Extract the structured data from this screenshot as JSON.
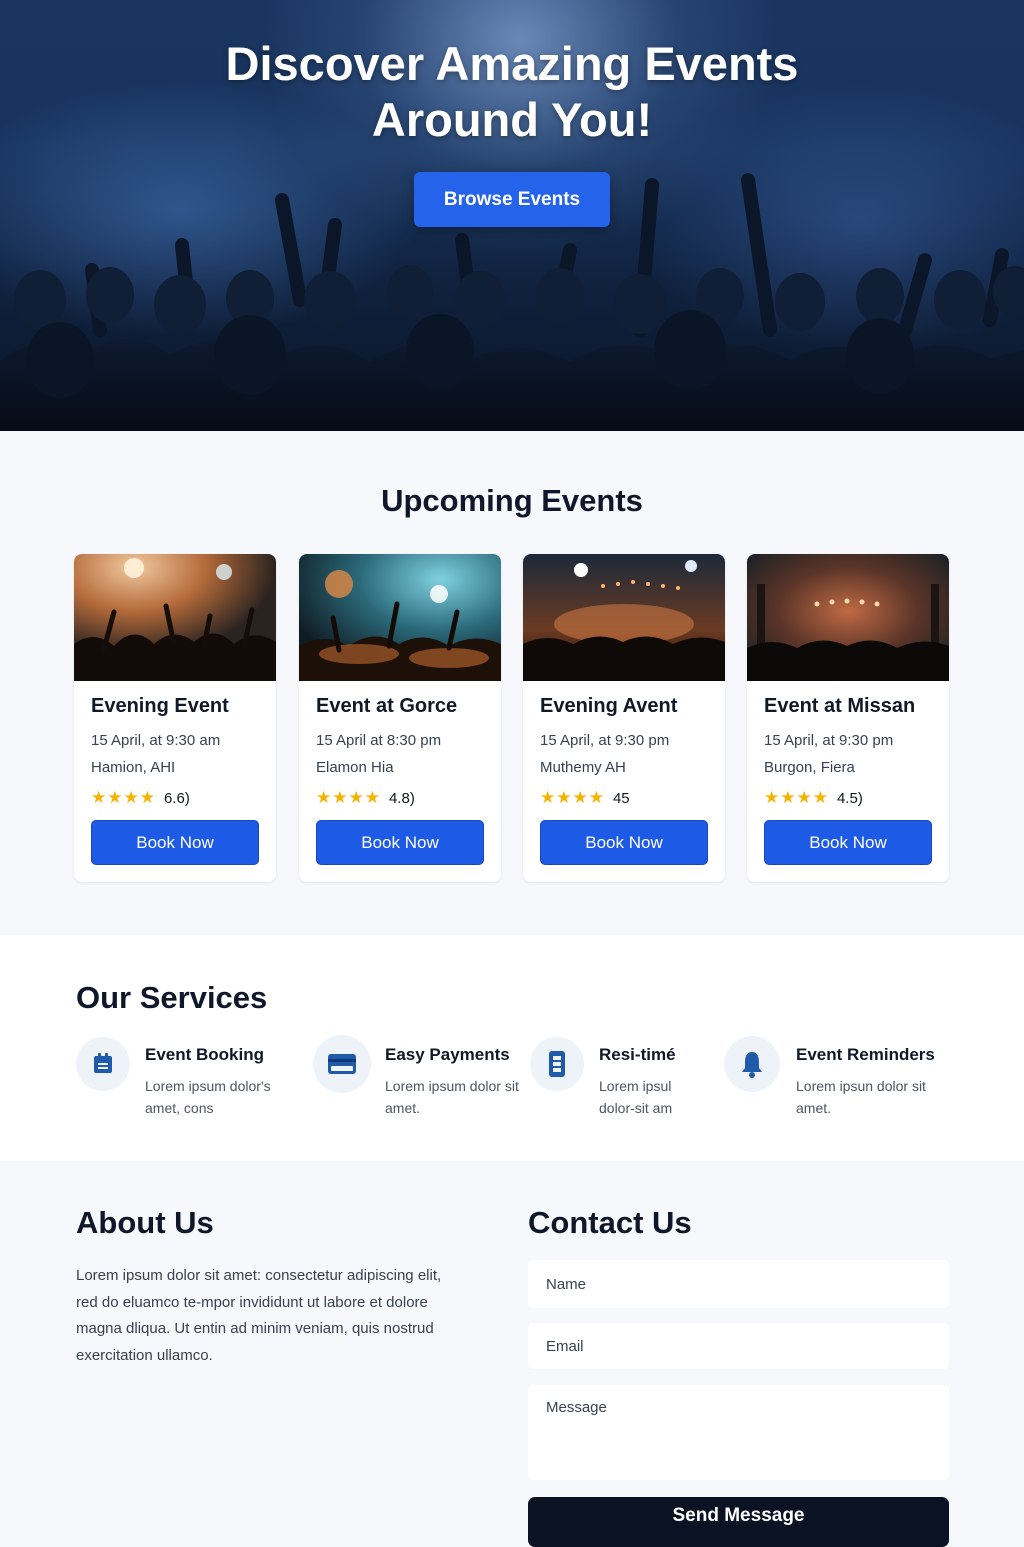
{
  "hero": {
    "title_line1": "Discover Amazing Events",
    "title_line2": "Around You!",
    "cta_label": "Browse Events"
  },
  "events": {
    "title": "Upcoming Events",
    "items": [
      {
        "name": "Evening Event",
        "date": "15 April, at 9:30 am",
        "location": "Hamion, AHI",
        "rating": "6.6)",
        "stars": "★★★★",
        "button": "Book Now"
      },
      {
        "name": "Event at Gorce",
        "date": "15 April at 8:30 pm",
        "location": "Elamon Hia",
        "rating": "4.8)",
        "stars": "★★★★",
        "button": "Book Now"
      },
      {
        "name": "Evening Avent",
        "date": "15 April, at 9:30 pm",
        "location": "Muthemy AH",
        "rating": "45",
        "stars": "★★★★",
        "button": "Book Now"
      },
      {
        "name": "Event at Missan",
        "date": "15 April, at 9:30 pm",
        "location": "Burgon, Fiera",
        "rating": "4.5)",
        "stars": "★★★★",
        "button": "Book Now"
      }
    ]
  },
  "services": {
    "title": "Our Services",
    "items": [
      {
        "name": "Event Booking",
        "desc": "Lorem ipsum dolor's amet, cons",
        "icon": "calendar-icon"
      },
      {
        "name": "Easy Payments",
        "desc": "Lorem ipsum dolor sit amet.",
        "icon": "credit-card-icon"
      },
      {
        "name": "Resi-timé",
        "desc": "Lorem ipsul dolor-sit am",
        "icon": "phone-icon"
      },
      {
        "name": "Event Reminders",
        "desc": "Lorem ipsun dolor sit amet.",
        "icon": "bell-icon"
      }
    ]
  },
  "about": {
    "title": "About Us",
    "text": "Lorem ipsum dolor sit amet: consectetur adipiscing elit, red do eluamco te-mpor invididunt ut labore et dolore magna dliqua. Ut entin ad minim veniam, quis nostrud exercitation ullamco."
  },
  "contact": {
    "title": "Contact Us",
    "name_placeholder": "Name",
    "email_placeholder": "Email",
    "message_placeholder": "Message",
    "submit_label": "Send Message"
  },
  "colors": {
    "accent": "#2563eb",
    "dark": "#0b1223",
    "star": "#f5b301"
  }
}
